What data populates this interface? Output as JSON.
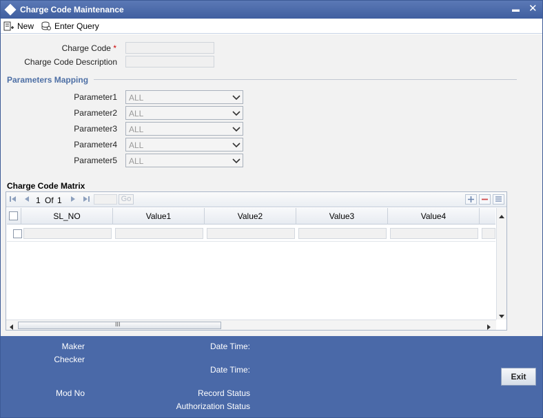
{
  "window": {
    "title": "Charge Code Maintenance",
    "minimize_glyph": "▬",
    "close_glyph": "✕"
  },
  "toolbar": {
    "new_label": "New",
    "enter_query_label": "Enter Query"
  },
  "form": {
    "charge_code_label": "Charge Code",
    "required_marker": "*",
    "charge_code_description_label": "Charge Code Description",
    "charge_code_value": "",
    "charge_code_description_value": ""
  },
  "parameters_mapping": {
    "title": "Parameters Mapping",
    "params": [
      {
        "label": "Parameter1",
        "value": "ALL"
      },
      {
        "label": "Parameter2",
        "value": "ALL"
      },
      {
        "label": "Parameter3",
        "value": "ALL"
      },
      {
        "label": "Parameter4",
        "value": "ALL"
      },
      {
        "label": "Parameter5",
        "value": "ALL"
      }
    ]
  },
  "matrix": {
    "title": "Charge Code Matrix",
    "page_current": "1",
    "page_of": "Of",
    "page_total": "1",
    "go_label": "Go",
    "columns": [
      "SL_NO",
      "Value1",
      "Value2",
      "Value3",
      "Value4"
    ],
    "hscroll_grip": "III"
  },
  "footer": {
    "maker_label": "Maker",
    "checker_label": "Checker",
    "date_time_label_1": "Date Time:",
    "date_time_label_2": "Date Time:",
    "mod_no_label": "Mod No",
    "record_status_label": "Record Status",
    "authorization_status_label": "Authorization Status",
    "exit_label": "Exit"
  },
  "colors": {
    "title_bar": "#4a69a8",
    "section_title": "#4d6fa5",
    "required": "#cc0000"
  }
}
